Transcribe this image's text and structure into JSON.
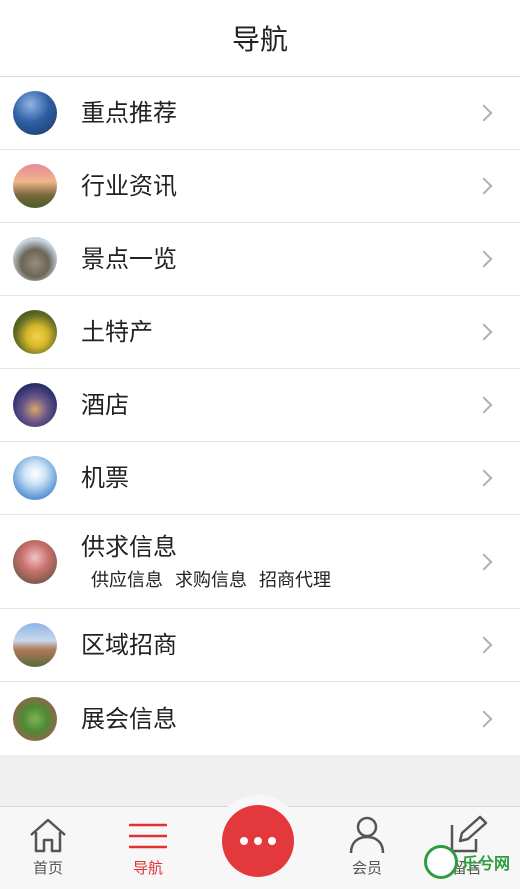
{
  "header": {
    "title": "导航"
  },
  "menu": [
    {
      "label": "重点推荐",
      "icon": "thumb-landscape-blue"
    },
    {
      "label": "行业资讯",
      "icon": "thumb-sunset-hill"
    },
    {
      "label": "景点一览",
      "icon": "thumb-rock-scenery"
    },
    {
      "label": "土特产",
      "icon": "thumb-fruit"
    },
    {
      "label": "酒店",
      "icon": "thumb-hotel-night"
    },
    {
      "label": "机票",
      "icon": "thumb-plane-sky"
    },
    {
      "label": "供求信息",
      "icon": "thumb-flower-tree",
      "subs": [
        "供应信息",
        "求购信息",
        "招商代理"
      ]
    },
    {
      "label": "区域招商",
      "icon": "thumb-bridge-town"
    },
    {
      "label": "展会信息",
      "icon": "thumb-green-karst"
    }
  ],
  "tabbar": {
    "home": "首页",
    "nav": "导航",
    "member": "会员",
    "message": "留言"
  },
  "watermark": "乐兮网",
  "colors": {
    "accent": "#e4393c",
    "active_tab": "#e03131"
  }
}
